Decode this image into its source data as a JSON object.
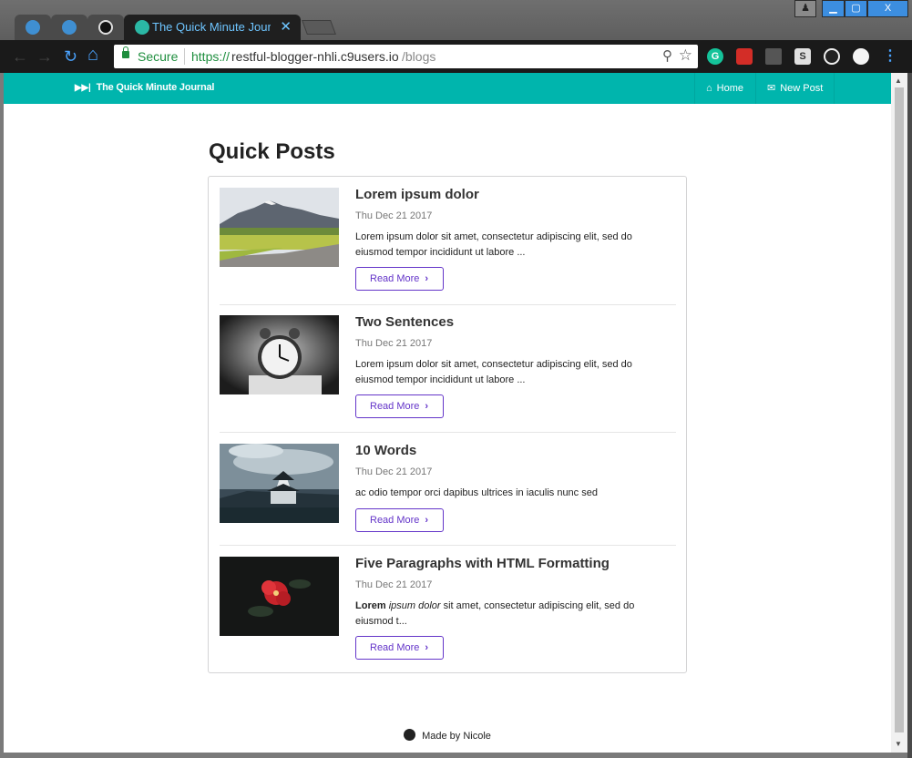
{
  "browser": {
    "active_tab_title": "The Quick Minute Journal",
    "tab_close": "✕",
    "address": {
      "secure_label": "Secure",
      "protocol": "https://",
      "host": "restful-blogger-nhli.c9users.io",
      "path": "/blogs"
    },
    "icons": [
      "back-icon",
      "forward-icon",
      "reload-icon",
      "home-icon",
      "zoom-icon",
      "bookmark-star-icon",
      "grammarly-icon",
      "lastpass-icon",
      "mail-icon",
      "s-extension-icon",
      "shield-extension-icon",
      "circle-extension-icon",
      "menu-icon"
    ],
    "ext_labels": {
      "s": "S"
    },
    "window_controls": {
      "user": "♟",
      "min": "▁",
      "max": "▢",
      "close": "X"
    }
  },
  "site": {
    "brand": "The Quick Minute Journal",
    "nav": {
      "home": "Home",
      "new_post": "New Post"
    },
    "accent": "#00b5ad",
    "button_color": "#6435c9"
  },
  "page": {
    "heading": "Quick Posts",
    "posts": [
      {
        "title": "Lorem ipsum dolor",
        "date": "Thu Dec 21 2017",
        "summary": "Lorem ipsum dolor sit amet, consectetur adipiscing elit, sed do eiusmod tempor incididunt ut labore ...",
        "button": "Read More",
        "image": "mountain-landscape-photo"
      },
      {
        "title": "Two Sentences",
        "date": "Thu Dec 21 2017",
        "summary": "Lorem ipsum dolor sit amet, consectetur adipiscing elit, sed do eiusmod tempor incididunt ut labore ...",
        "button": "Read More",
        "image": "alarm-clock-photo"
      },
      {
        "title": "10 Words",
        "date": "Thu Dec 21 2017",
        "summary": "ac odio tempor orci dapibus ultrices in iaculis nunc sed",
        "button": "Read More",
        "image": "japanese-castle-photo"
      },
      {
        "title": "Five Paragraphs with HTML Formatting",
        "date": "Thu Dec 21 2017",
        "summary_bold": "Lorem",
        "summary_italic": "ipsum dolor",
        "summary_rest": "sit amet, consectetur adipiscing elit, sed do eiusmod t...",
        "button": "Read More",
        "image": "red-flower-photo"
      }
    ]
  },
  "footer": {
    "text": "Made by Nicole"
  }
}
